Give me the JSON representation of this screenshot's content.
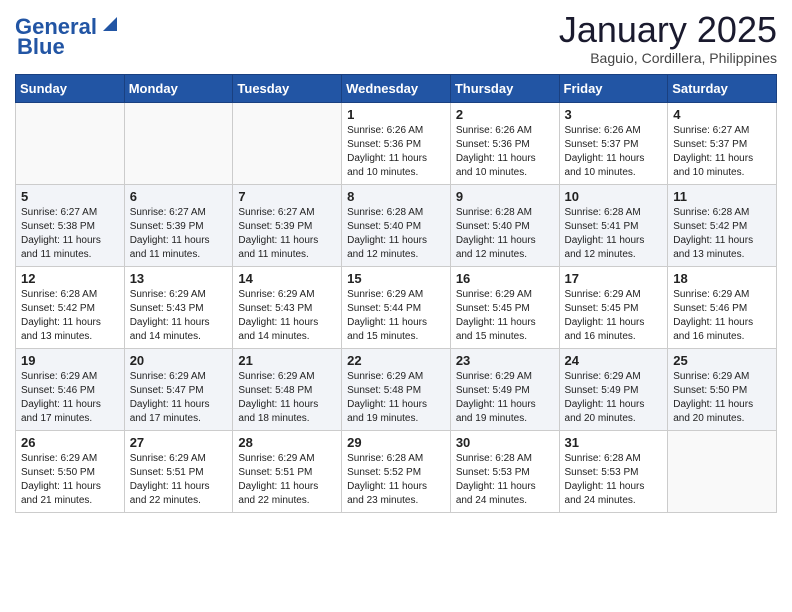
{
  "header": {
    "logo_line1": "General",
    "logo_line2": "Blue",
    "month_title": "January 2025",
    "location": "Baguio, Cordillera, Philippines"
  },
  "days_of_week": [
    "Sunday",
    "Monday",
    "Tuesday",
    "Wednesday",
    "Thursday",
    "Friday",
    "Saturday"
  ],
  "weeks": [
    [
      {
        "day": "",
        "info": ""
      },
      {
        "day": "",
        "info": ""
      },
      {
        "day": "",
        "info": ""
      },
      {
        "day": "1",
        "info": "Sunrise: 6:26 AM\nSunset: 5:36 PM\nDaylight: 11 hours and 10 minutes."
      },
      {
        "day": "2",
        "info": "Sunrise: 6:26 AM\nSunset: 5:36 PM\nDaylight: 11 hours and 10 minutes."
      },
      {
        "day": "3",
        "info": "Sunrise: 6:26 AM\nSunset: 5:37 PM\nDaylight: 11 hours and 10 minutes."
      },
      {
        "day": "4",
        "info": "Sunrise: 6:27 AM\nSunset: 5:37 PM\nDaylight: 11 hours and 10 minutes."
      }
    ],
    [
      {
        "day": "5",
        "info": "Sunrise: 6:27 AM\nSunset: 5:38 PM\nDaylight: 11 hours and 11 minutes."
      },
      {
        "day": "6",
        "info": "Sunrise: 6:27 AM\nSunset: 5:39 PM\nDaylight: 11 hours and 11 minutes."
      },
      {
        "day": "7",
        "info": "Sunrise: 6:27 AM\nSunset: 5:39 PM\nDaylight: 11 hours and 11 minutes."
      },
      {
        "day": "8",
        "info": "Sunrise: 6:28 AM\nSunset: 5:40 PM\nDaylight: 11 hours and 12 minutes."
      },
      {
        "day": "9",
        "info": "Sunrise: 6:28 AM\nSunset: 5:40 PM\nDaylight: 11 hours and 12 minutes."
      },
      {
        "day": "10",
        "info": "Sunrise: 6:28 AM\nSunset: 5:41 PM\nDaylight: 11 hours and 12 minutes."
      },
      {
        "day": "11",
        "info": "Sunrise: 6:28 AM\nSunset: 5:42 PM\nDaylight: 11 hours and 13 minutes."
      }
    ],
    [
      {
        "day": "12",
        "info": "Sunrise: 6:28 AM\nSunset: 5:42 PM\nDaylight: 11 hours and 13 minutes."
      },
      {
        "day": "13",
        "info": "Sunrise: 6:29 AM\nSunset: 5:43 PM\nDaylight: 11 hours and 14 minutes."
      },
      {
        "day": "14",
        "info": "Sunrise: 6:29 AM\nSunset: 5:43 PM\nDaylight: 11 hours and 14 minutes."
      },
      {
        "day": "15",
        "info": "Sunrise: 6:29 AM\nSunset: 5:44 PM\nDaylight: 11 hours and 15 minutes."
      },
      {
        "day": "16",
        "info": "Sunrise: 6:29 AM\nSunset: 5:45 PM\nDaylight: 11 hours and 15 minutes."
      },
      {
        "day": "17",
        "info": "Sunrise: 6:29 AM\nSunset: 5:45 PM\nDaylight: 11 hours and 16 minutes."
      },
      {
        "day": "18",
        "info": "Sunrise: 6:29 AM\nSunset: 5:46 PM\nDaylight: 11 hours and 16 minutes."
      }
    ],
    [
      {
        "day": "19",
        "info": "Sunrise: 6:29 AM\nSunset: 5:46 PM\nDaylight: 11 hours and 17 minutes."
      },
      {
        "day": "20",
        "info": "Sunrise: 6:29 AM\nSunset: 5:47 PM\nDaylight: 11 hours and 17 minutes."
      },
      {
        "day": "21",
        "info": "Sunrise: 6:29 AM\nSunset: 5:48 PM\nDaylight: 11 hours and 18 minutes."
      },
      {
        "day": "22",
        "info": "Sunrise: 6:29 AM\nSunset: 5:48 PM\nDaylight: 11 hours and 19 minutes."
      },
      {
        "day": "23",
        "info": "Sunrise: 6:29 AM\nSunset: 5:49 PM\nDaylight: 11 hours and 19 minutes."
      },
      {
        "day": "24",
        "info": "Sunrise: 6:29 AM\nSunset: 5:49 PM\nDaylight: 11 hours and 20 minutes."
      },
      {
        "day": "25",
        "info": "Sunrise: 6:29 AM\nSunset: 5:50 PM\nDaylight: 11 hours and 20 minutes."
      }
    ],
    [
      {
        "day": "26",
        "info": "Sunrise: 6:29 AM\nSunset: 5:50 PM\nDaylight: 11 hours and 21 minutes."
      },
      {
        "day": "27",
        "info": "Sunrise: 6:29 AM\nSunset: 5:51 PM\nDaylight: 11 hours and 22 minutes."
      },
      {
        "day": "28",
        "info": "Sunrise: 6:29 AM\nSunset: 5:51 PM\nDaylight: 11 hours and 22 minutes."
      },
      {
        "day": "29",
        "info": "Sunrise: 6:28 AM\nSunset: 5:52 PM\nDaylight: 11 hours and 23 minutes."
      },
      {
        "day": "30",
        "info": "Sunrise: 6:28 AM\nSunset: 5:53 PM\nDaylight: 11 hours and 24 minutes."
      },
      {
        "day": "31",
        "info": "Sunrise: 6:28 AM\nSunset: 5:53 PM\nDaylight: 11 hours and 24 minutes."
      },
      {
        "day": "",
        "info": ""
      }
    ]
  ]
}
